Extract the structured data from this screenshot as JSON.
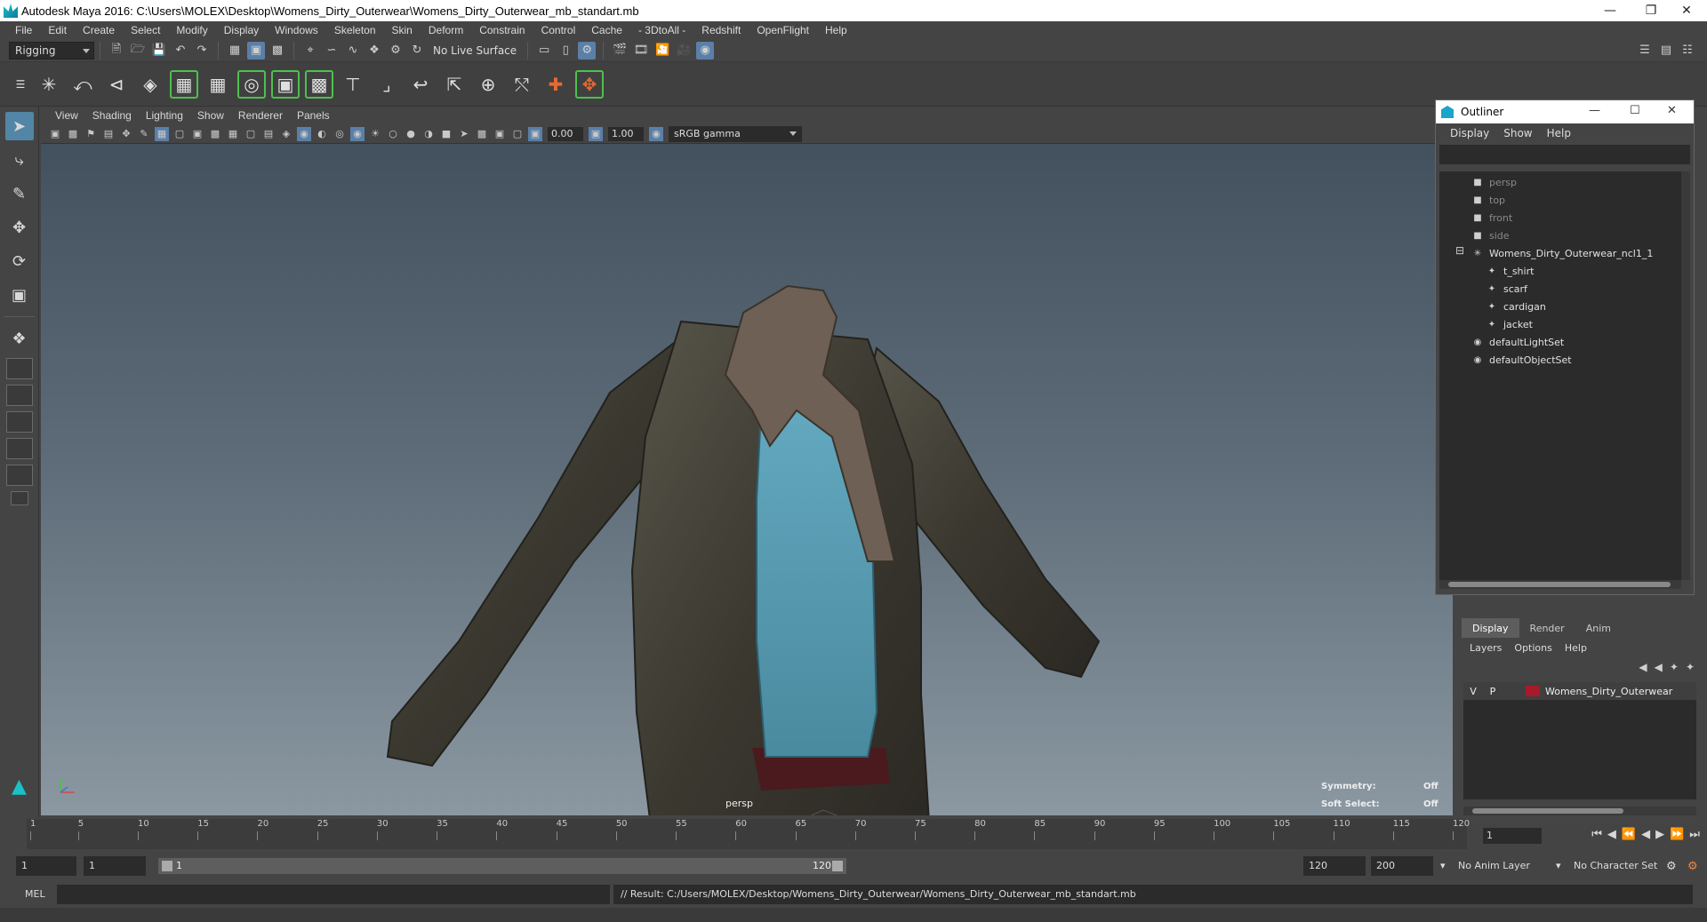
{
  "window": {
    "title": "Autodesk Maya 2016: C:\\Users\\MOLEX\\Desktop\\Womens_Dirty_Outerwear\\Womens_Dirty_Outerwear_mb_standart.mb"
  },
  "menubar": {
    "items": [
      "File",
      "Edit",
      "Create",
      "Select",
      "Modify",
      "Display",
      "Windows",
      "Skeleton",
      "Skin",
      "Deform",
      "Constrain",
      "Control",
      "Cache",
      "- 3DtoAll -",
      "Redshift",
      "OpenFlight",
      "Help"
    ]
  },
  "statusline": {
    "menuset": "Rigging",
    "live_surface": "No Live Surface"
  },
  "viewport": {
    "menu": [
      "View",
      "Shading",
      "Lighting",
      "Show",
      "Renderer",
      "Panels"
    ],
    "exposure": "0.00",
    "gamma_value": "1.00",
    "color_space": "sRGB gamma",
    "camera_label": "persp",
    "hud": {
      "symmetry_label": "Symmetry:",
      "symmetry_value": "Off",
      "soft_select_label": "Soft Select:",
      "soft_select_value": "Off"
    }
  },
  "outliner": {
    "title": "Outliner",
    "menu": [
      "Display",
      "Show",
      "Help"
    ],
    "items": [
      {
        "label": "persp",
        "icon": "camera-icon",
        "dim": true
      },
      {
        "label": "top",
        "icon": "camera-icon",
        "dim": true
      },
      {
        "label": "front",
        "icon": "camera-icon",
        "dim": true
      },
      {
        "label": "side",
        "icon": "camera-icon",
        "dim": true
      },
      {
        "label": "Womens_Dirty_Outerwear_ncl1_1",
        "icon": "group-icon"
      },
      {
        "label": "t_shirt",
        "icon": "mesh-icon"
      },
      {
        "label": "scarf",
        "icon": "mesh-icon"
      },
      {
        "label": "cardigan",
        "icon": "mesh-icon"
      },
      {
        "label": "jacket",
        "icon": "mesh-icon"
      },
      {
        "label": "defaultLightSet",
        "icon": "set-icon"
      },
      {
        "label": "defaultObjectSet",
        "icon": "set-icon"
      }
    ]
  },
  "layer_editor": {
    "tabs": [
      "Display",
      "Render",
      "Anim"
    ],
    "active_tab": "Display",
    "menu": [
      "Layers",
      "Options",
      "Help"
    ],
    "layers": [
      {
        "v": "V",
        "p": "P",
        "name": "Womens_Dirty_Outerwear",
        "color": "#a51b2a"
      }
    ]
  },
  "timeline": {
    "ticks": [
      "1",
      "5",
      "10",
      "15",
      "20",
      "25",
      "30",
      "35",
      "40",
      "45",
      "50",
      "55",
      "60",
      "65",
      "70",
      "75",
      "80",
      "85",
      "90",
      "95",
      "100",
      "105",
      "110",
      "115",
      "120"
    ],
    "current_frame": "1"
  },
  "range": {
    "start": "1",
    "playback_start": "1",
    "slider_start": "1",
    "slider_end": "120",
    "playback_end": "120",
    "end": "200",
    "anim_layer": "No Anim Layer",
    "character_set": "No Character Set"
  },
  "cmdline": {
    "mode": "MEL",
    "result": "// Result: C:/Users/MOLEX/Desktop/Womens_Dirty_Outerwear/Womens_Dirty_Outerwear_mb_standart.mb"
  },
  "colors": {
    "accent": "#5285a6",
    "layer_color": "#a51b2a",
    "green_outline": "#4ec04e"
  }
}
